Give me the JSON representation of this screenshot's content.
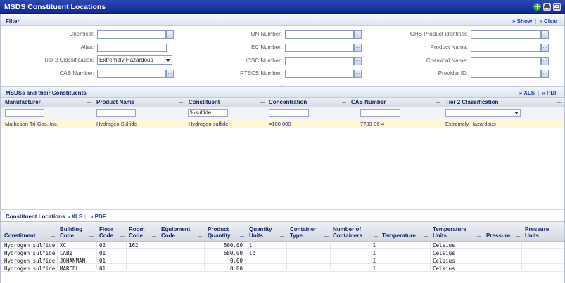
{
  "window": {
    "title": "MSDS Constituent Locations",
    "icons": [
      "add-icon",
      "print-icon",
      "email-icon"
    ]
  },
  "filter": {
    "label": "Filter",
    "show_label": "» Show",
    "clear_label": "» Clear",
    "fields": {
      "chemical": {
        "label": "Chemical:",
        "value": ""
      },
      "alias": {
        "label": "Alias:",
        "value": ""
      },
      "tier2": {
        "label": "Tier 2 Classification:",
        "value": "Extremely Hazardous"
      },
      "cas": {
        "label": "CAS Number:",
        "value": ""
      },
      "un": {
        "label": "UN Number:",
        "value": ""
      },
      "ec": {
        "label": "EC Number:",
        "value": ""
      },
      "icsc": {
        "label": "ICSC Number:",
        "value": ""
      },
      "rtecs": {
        "label": "RTECS Number:",
        "value": ""
      },
      "ghs": {
        "label": "GHS Product Identifier:",
        "value": ""
      },
      "product_name": {
        "label": "Product Name:",
        "value": ""
      },
      "chemical_name": {
        "label": "Chemical Name:",
        "value": ""
      },
      "provider_id": {
        "label": "Provider ID:",
        "value": ""
      }
    },
    "lookup_button": "..."
  },
  "msds": {
    "label": "MSDSs and their Constituents",
    "xls_label": "» XLS",
    "pdf_label": "» PDF",
    "columns": [
      "Manufacturer",
      "Product Name",
      "Constituent",
      "Concentration",
      "CAS Number",
      "Tier 2 Classification"
    ],
    "filter_values": {
      "constituent": "%sulfide"
    },
    "rows": [
      {
        "manufacturer": "Matheson Tri-Gas, Inc.",
        "product": "Hydrogen Sulfide",
        "constituent": "Hydrogen sulfide",
        "concentration": "=100.000",
        "cas": "7783-06-4",
        "tier2": "Extremely Hazardous"
      }
    ]
  },
  "locations": {
    "label": "Constituent Locations",
    "xls_label": "» XLS",
    "pdf_label": "» PDF",
    "columns": [
      {
        "line1": "Constituent",
        "line2": "",
        "line3": ""
      },
      {
        "line1": "Building",
        "line2": "Code",
        "line3": ""
      },
      {
        "line1": "Floor",
        "line2": "Code",
        "line3": ""
      },
      {
        "line1": "Room",
        "line2": "Code",
        "line3": ""
      },
      {
        "line1": "Equipment",
        "line2": "Code",
        "line3": ""
      },
      {
        "line1": "Product",
        "line2": "Quantity",
        "line3": ""
      },
      {
        "line1": "Quantity",
        "line2": "Units",
        "line3": ""
      },
      {
        "line1": "Container",
        "line2": "Type",
        "line3": ""
      },
      {
        "line1": "Number of",
        "line2": "Containers",
        "line3": ""
      },
      {
        "line1": "Temperature",
        "line2": "",
        "line3": ""
      },
      {
        "line1": "Temperature",
        "line2": "Units",
        "line3": ""
      },
      {
        "line1": "Pressure",
        "line2": "",
        "line3": ""
      },
      {
        "line1": "Pressure",
        "line2": "Units",
        "line3": ""
      }
    ],
    "rows": [
      {
        "constituent": "Hydrogen sulfide",
        "building": "XC",
        "floor": "02",
        "room": "162",
        "equipment": "",
        "quantity": "500.00",
        "units": "l",
        "container": "",
        "num": "1",
        "temp": "",
        "temp_units": "Celsius",
        "pressure": "",
        "pressure_units": ""
      },
      {
        "constituent": "Hydrogen sulfide",
        "building": "LAB1",
        "floor": "01",
        "room": "",
        "equipment": "",
        "quantity": "680.00",
        "units": "lb",
        "container": "",
        "num": "1",
        "temp": "",
        "temp_units": "Celsius",
        "pressure": "",
        "pressure_units": ""
      },
      {
        "constituent": "Hydrogen sulfide",
        "building": "JOHANMAN",
        "floor": "01",
        "room": "",
        "equipment": "",
        "quantity": "0.00",
        "units": "",
        "container": "",
        "num": "1",
        "temp": "",
        "temp_units": "Celsius",
        "pressure": "",
        "pressure_units": ""
      },
      {
        "constituent": "Hydrogen sulfide",
        "building": "MARCEL",
        "floor": "01",
        "room": "",
        "equipment": "",
        "quantity": "0.00",
        "units": "",
        "container": "",
        "num": "1",
        "temp": "",
        "temp_units": "Celsius",
        "pressure": "",
        "pressure_units": ""
      }
    ]
  }
}
